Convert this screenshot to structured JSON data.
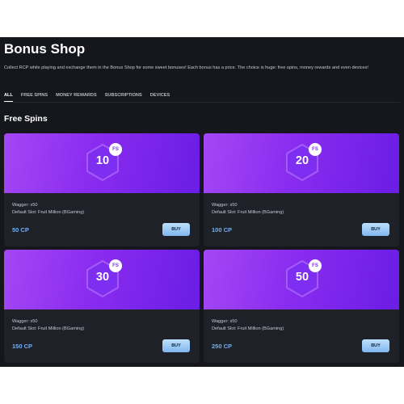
{
  "header": {
    "title": "Bonus Shop",
    "description": "Collect RCP while playing and exchange them in the Bonus Shop for some sweet bonuses! Each bonus has a price. The choice is huge: free spins, money rewards and even devices!"
  },
  "tabs": [
    {
      "label": "ALL",
      "active": true
    },
    {
      "label": "FREE SPINS",
      "active": false
    },
    {
      "label": "MONEY REWARDS",
      "active": false
    },
    {
      "label": "SUBSCRIPTIONS",
      "active": false
    },
    {
      "label": "DEVICES",
      "active": false
    }
  ],
  "section": {
    "title": "Free Spins"
  },
  "cards": [
    {
      "spins": "10",
      "badge": "FS",
      "wagger": "Wagger: x50",
      "slot": "Default Slot: Fruit Million (BGaming)",
      "price": "50 CP",
      "buy_label": "BUY"
    },
    {
      "spins": "20",
      "badge": "FS",
      "wagger": "Wagger: x50",
      "slot": "Default Slot: Fruit Million (BGaming)",
      "price": "100 CP",
      "buy_label": "BUY"
    },
    {
      "spins": "30",
      "badge": "FS",
      "wagger": "Wagger: x50",
      "slot": "Default Slot: Fruit Million (BGaming)",
      "price": "150 CP",
      "buy_label": "BUY"
    },
    {
      "spins": "50",
      "badge": "FS",
      "wagger": "Wagger: x50",
      "slot": "Default Slot: Fruit Million (BGaming)",
      "price": "250 CP",
      "buy_label": "BUY"
    }
  ],
  "colors": {
    "background": "#15171c",
    "card": "#1f2129",
    "accent_purple": "#8a2cf0",
    "price_blue": "#6fb1f5"
  }
}
